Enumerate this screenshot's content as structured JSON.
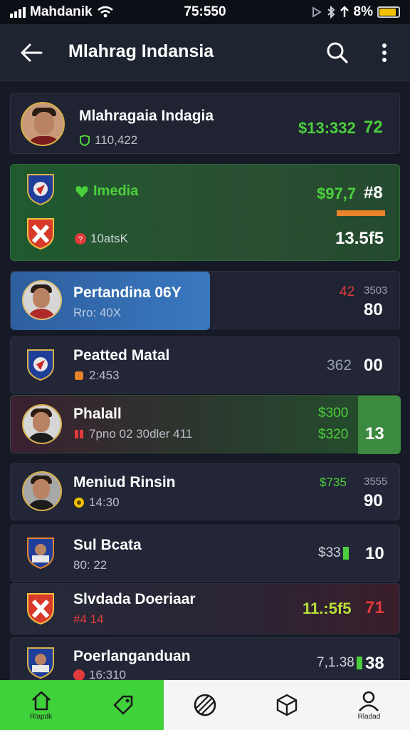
{
  "status_bar": {
    "carrier": "Mahdanik",
    "time": "75:550",
    "battery": "8%"
  },
  "header": {
    "title": "Mlahrag Indansia"
  },
  "rows": [
    {
      "name": "Mlahragaia Indagia",
      "sub": "110,422",
      "value_a": "$13:332",
      "value_b": "72"
    },
    {
      "name": "Imedia",
      "sub": "10atsK",
      "value_a": "$97,7",
      "value_b": "#8",
      "value_c": "13.5f5"
    },
    {
      "name": "Pertandina 06Y",
      "sub": "Rro: 40X",
      "value_a": "42",
      "value_a2": "3503",
      "value_b": "80"
    },
    {
      "name": "Peatted Matal",
      "sub": "2:453",
      "value_a": "362",
      "value_b": "00"
    },
    {
      "name": "Phalall",
      "sub": "7pno 02 30dler 411",
      "value_a": "$300",
      "value_a2": "$320",
      "value_b": "13"
    },
    {
      "name": "Meniud Rinsin",
      "sub": "14:30",
      "value_a": "$735",
      "value_a2": "3555",
      "value_b": "90"
    },
    {
      "name": "Sul Bcata",
      "sub": "80: 22",
      "value_a": "$33",
      "value_b": "10"
    },
    {
      "name": "Slvdada Doeriaar",
      "sub": "#4 14",
      "value_a": "11.:5f5",
      "value_b": "71"
    },
    {
      "name": "Poerlanganduan",
      "sub": "16:310",
      "value_a": "7,1.38",
      "value_b": "38"
    }
  ],
  "nav": {
    "home_label": "Rlapdk",
    "profile_label": "Rladad"
  },
  "colors": {
    "accent_green": "#3fd23a",
    "value_green": "#4ccf3c",
    "value_red": "#e03a3a",
    "selected_blue": "#2f6fb8"
  },
  "icons": [
    "back-arrow-icon",
    "search-icon",
    "more-vertical-icon",
    "home-icon",
    "tag-icon",
    "ball-icon",
    "box-icon",
    "profile-icon"
  ]
}
